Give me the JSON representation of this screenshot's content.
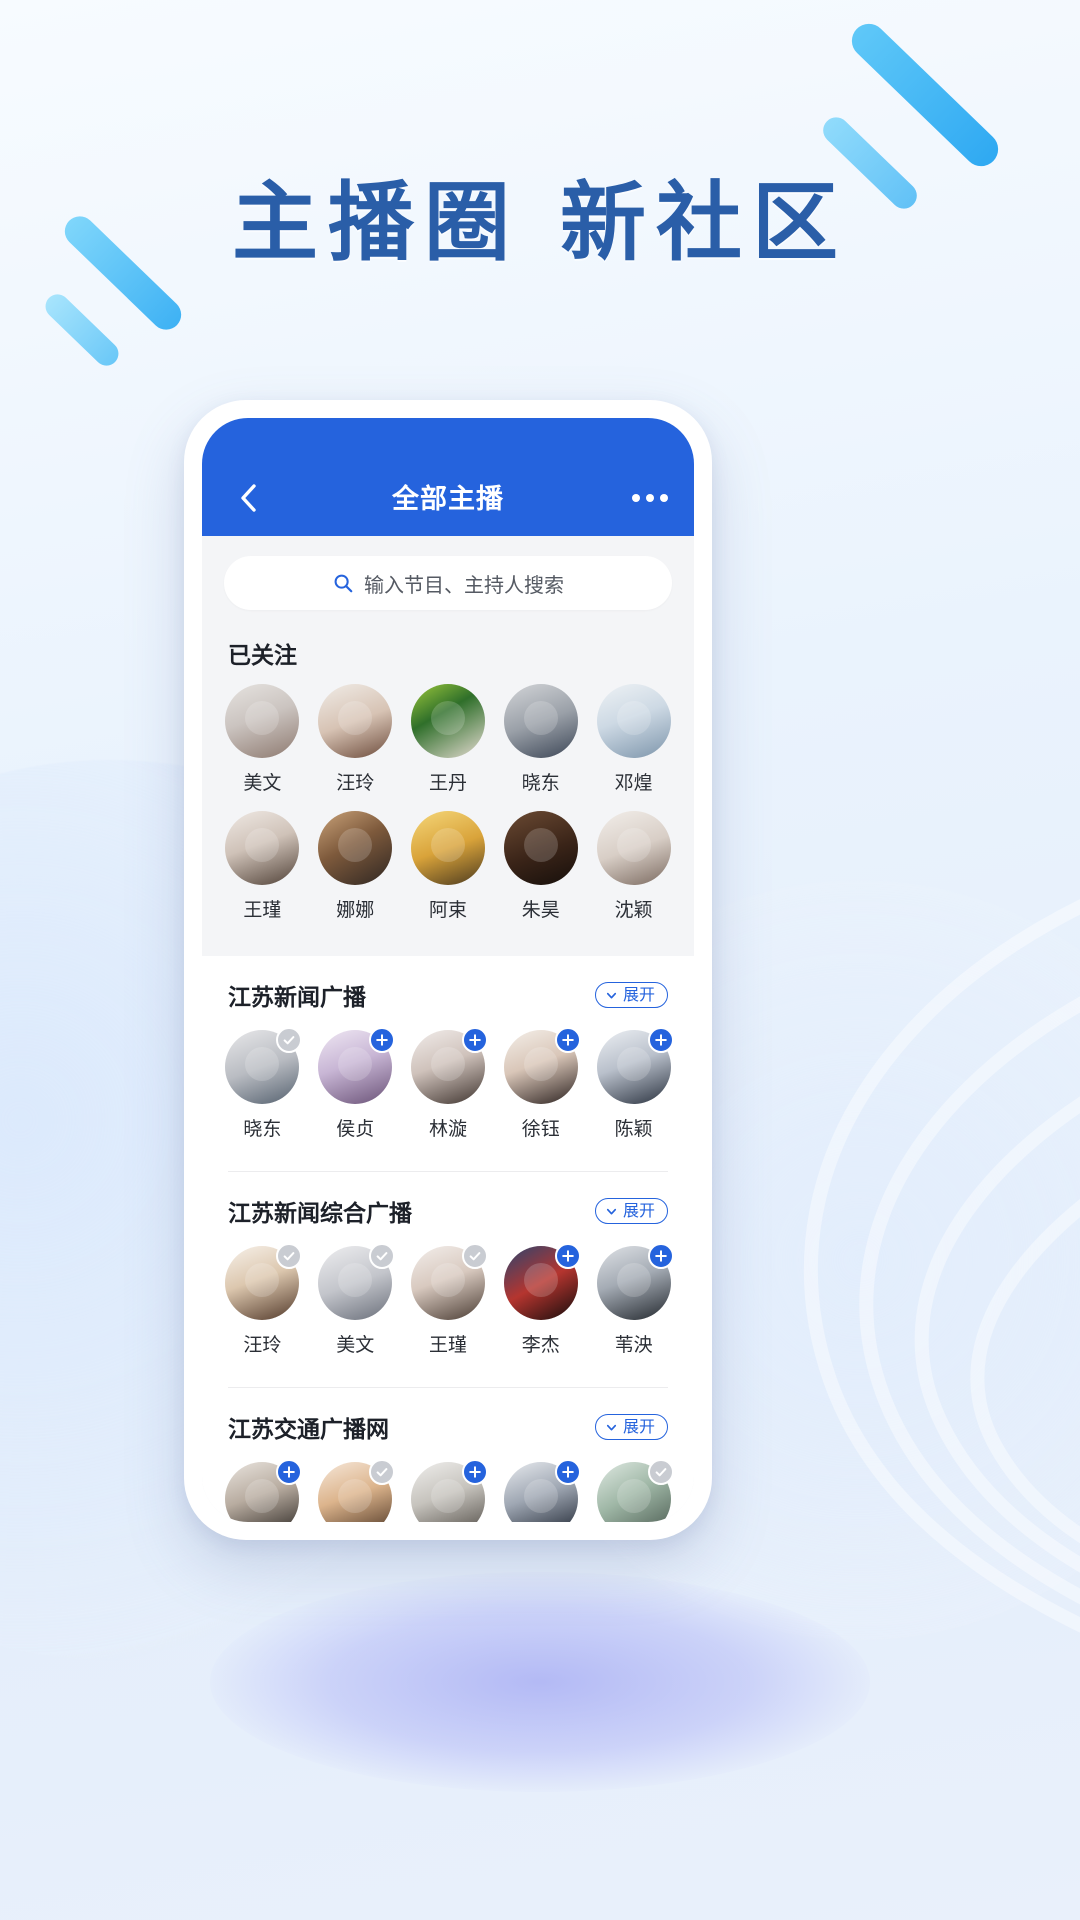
{
  "poster": {
    "headline": "主播圈 新社区"
  },
  "app": {
    "title": "全部主播",
    "back_icon": "chevron-left-icon",
    "more_icon": "more-horizontal-icon"
  },
  "search": {
    "icon": "search-icon",
    "placeholder": "输入节目、主持人搜索",
    "value": ""
  },
  "followed": {
    "title": "已关注",
    "hosts": [
      {
        "name": "美文",
        "photo": "p1"
      },
      {
        "name": "汪玲",
        "photo": "p2"
      },
      {
        "name": "王丹",
        "photo": "p3"
      },
      {
        "name": "晓东",
        "photo": "p4"
      },
      {
        "name": "邓煌",
        "photo": "p5"
      },
      {
        "name": "王瑾",
        "photo": "p6"
      },
      {
        "name": "娜娜",
        "photo": "p7"
      },
      {
        "name": "阿束",
        "photo": "p8"
      },
      {
        "name": "朱昊",
        "photo": "p9"
      },
      {
        "name": "沈颖",
        "photo": "p10"
      }
    ]
  },
  "expand_label": "展开",
  "expand_icon": "chevron-down-icon",
  "badge_add_icon": "plus-icon",
  "badge_done_icon": "check-icon",
  "stations": [
    {
      "name": "江苏新闻广播",
      "hosts": [
        {
          "name": "晓东",
          "photo": "p11",
          "badge": "done"
        },
        {
          "name": "侯贞",
          "photo": "p12",
          "badge": "add"
        },
        {
          "name": "林漩",
          "photo": "p13",
          "badge": "add"
        },
        {
          "name": "徐钰",
          "photo": "p14",
          "badge": "add"
        },
        {
          "name": "陈颖",
          "photo": "p15",
          "badge": "add"
        }
      ]
    },
    {
      "name": "江苏新闻综合广播",
      "hosts": [
        {
          "name": "汪玲",
          "photo": "p16",
          "badge": "done"
        },
        {
          "name": "美文",
          "photo": "p17",
          "badge": "done"
        },
        {
          "name": "王瑾",
          "photo": "p18",
          "badge": "done"
        },
        {
          "name": "李杰",
          "photo": "p19",
          "badge": "add"
        },
        {
          "name": "苇泱",
          "photo": "p20",
          "badge": "add"
        }
      ]
    },
    {
      "name": "江苏交通广播网",
      "hosts": [
        {
          "name": "",
          "photo": "p21",
          "badge": "add"
        },
        {
          "name": "",
          "photo": "p22",
          "badge": "done"
        },
        {
          "name": "",
          "photo": "p23",
          "badge": "add"
        },
        {
          "name": "",
          "photo": "p24",
          "badge": "add"
        },
        {
          "name": "",
          "photo": "p25",
          "badge": "done"
        }
      ]
    }
  ],
  "colors": {
    "brand_blue": "#2563dd",
    "headline_blue": "#2a5ea8",
    "badge_gray": "#c9ccd2",
    "page_bg": "#f4f5f7"
  }
}
